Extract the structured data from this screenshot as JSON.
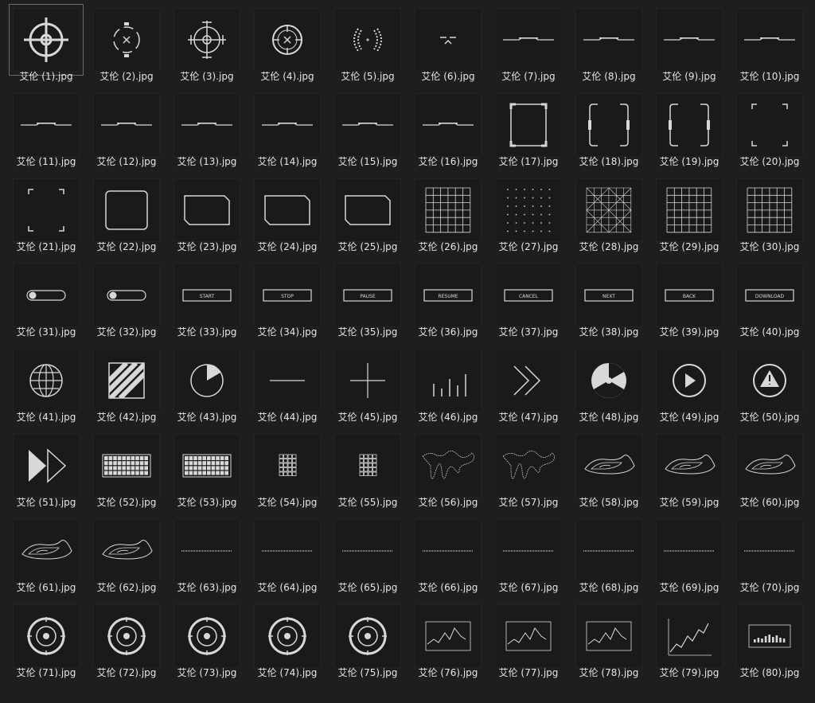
{
  "files": [
    {
      "name": "艾伦 (1).jpg",
      "icon": "crosshair-icon"
    },
    {
      "name": "艾伦 (2).jpg",
      "icon": "crosshair-x-icon"
    },
    {
      "name": "艾伦 (3).jpg",
      "icon": "crosshair-tick-icon"
    },
    {
      "name": "艾伦 (4).jpg",
      "icon": "crosshair-ring-icon"
    },
    {
      "name": "艾伦 (5).jpg",
      "icon": "bracket-arc-icon"
    },
    {
      "name": "艾伦 (6).jpg",
      "icon": "caret-mark-icon"
    },
    {
      "name": "艾伦 (7).jpg",
      "icon": "hud-line-icon"
    },
    {
      "name": "艾伦 (8).jpg",
      "icon": "hud-line-icon"
    },
    {
      "name": "艾伦 (9).jpg",
      "icon": "hud-line-icon"
    },
    {
      "name": "艾伦 (10).jpg",
      "icon": "hud-line-icon"
    },
    {
      "name": "艾伦 (11).jpg",
      "icon": "hud-line-icon"
    },
    {
      "name": "艾伦 (12).jpg",
      "icon": "hud-line-icon"
    },
    {
      "name": "艾伦 (13).jpg",
      "icon": "hud-line-icon"
    },
    {
      "name": "艾伦 (14).jpg",
      "icon": "hud-line-icon"
    },
    {
      "name": "艾伦 (15).jpg",
      "icon": "hud-line-icon"
    },
    {
      "name": "艾伦 (16).jpg",
      "icon": "hud-line-icon"
    },
    {
      "name": "艾伦 (17).jpg",
      "icon": "square-frame-icon"
    },
    {
      "name": "艾伦 (18).jpg",
      "icon": "bracket-frame-icon"
    },
    {
      "name": "艾伦 (19).jpg",
      "icon": "bracket-frame-icon"
    },
    {
      "name": "艾伦 (20).jpg",
      "icon": "corner-frame-icon"
    },
    {
      "name": "艾伦 (21).jpg",
      "icon": "corner-frame-icon"
    },
    {
      "name": "艾伦 (22).jpg",
      "icon": "rounded-frame-icon"
    },
    {
      "name": "艾伦 (23).jpg",
      "icon": "panel-frame-icon"
    },
    {
      "name": "艾伦 (24).jpg",
      "icon": "panel-frame-icon"
    },
    {
      "name": "艾伦 (25).jpg",
      "icon": "panel-frame-icon"
    },
    {
      "name": "艾伦 (26).jpg",
      "icon": "grid-icon"
    },
    {
      "name": "艾伦 (27).jpg",
      "icon": "dot-grid-icon"
    },
    {
      "name": "艾伦 (28).jpg",
      "icon": "diagonal-grid-icon"
    },
    {
      "name": "艾伦 (29).jpg",
      "icon": "grid-icon"
    },
    {
      "name": "艾伦 (30).jpg",
      "icon": "grid-icon"
    },
    {
      "name": "艾伦 (31).jpg",
      "icon": "toggle-icon"
    },
    {
      "name": "艾伦 (32).jpg",
      "icon": "toggle-icon"
    },
    {
      "name": "艾伦 (33).jpg",
      "icon": "button-icon",
      "text": "START"
    },
    {
      "name": "艾伦 (34).jpg",
      "icon": "button-icon",
      "text": "STOP"
    },
    {
      "name": "艾伦 (35).jpg",
      "icon": "button-icon",
      "text": "PAUSE"
    },
    {
      "name": "艾伦 (36).jpg",
      "icon": "button-icon",
      "text": "RESUME"
    },
    {
      "name": "艾伦 (37).jpg",
      "icon": "button-icon",
      "text": "CANCEL"
    },
    {
      "name": "艾伦 (38).jpg",
      "icon": "button-icon",
      "text": "NEXT"
    },
    {
      "name": "艾伦 (39).jpg",
      "icon": "button-icon",
      "text": "BACK"
    },
    {
      "name": "艾伦 (40).jpg",
      "icon": "button-icon",
      "text": "DOWNLOAD"
    },
    {
      "name": "艾伦 (41).jpg",
      "icon": "globe-icon"
    },
    {
      "name": "艾伦 (42).jpg",
      "icon": "hazard-stripes-icon"
    },
    {
      "name": "艾伦 (43).jpg",
      "icon": "pie-circle-icon"
    },
    {
      "name": "艾伦 (44).jpg",
      "icon": "minus-icon"
    },
    {
      "name": "艾伦 (45).jpg",
      "icon": "plus-icon"
    },
    {
      "name": "艾伦 (46).jpg",
      "icon": "bars-icon"
    },
    {
      "name": "艾伦 (47).jpg",
      "icon": "double-chevron-icon"
    },
    {
      "name": "艾伦 (48).jpg",
      "icon": "radiation-icon"
    },
    {
      "name": "艾伦 (49).jpg",
      "icon": "play-circle-icon"
    },
    {
      "name": "艾伦 (50).jpg",
      "icon": "warning-circle-icon"
    },
    {
      "name": "艾伦 (51).jpg",
      "icon": "fast-forward-icon"
    },
    {
      "name": "艾伦 (52).jpg",
      "icon": "keyboard-icon"
    },
    {
      "name": "艾伦 (53).jpg",
      "icon": "keyboard-icon"
    },
    {
      "name": "艾伦 (54).jpg",
      "icon": "keypad-icon"
    },
    {
      "name": "艾伦 (55).jpg",
      "icon": "keypad-icon"
    },
    {
      "name": "艾伦 (56).jpg",
      "icon": "world-map-icon"
    },
    {
      "name": "艾伦 (57).jpg",
      "icon": "world-map-icon"
    },
    {
      "name": "艾伦 (58).jpg",
      "icon": "terrain-icon"
    },
    {
      "name": "艾伦 (59).jpg",
      "icon": "terrain-icon"
    },
    {
      "name": "艾伦 (60).jpg",
      "icon": "terrain-icon"
    },
    {
      "name": "艾伦 (61).jpg",
      "icon": "terrain-icon"
    },
    {
      "name": "艾伦 (62).jpg",
      "icon": "terrain-icon"
    },
    {
      "name": "艾伦 (63).jpg",
      "icon": "dotted-line-icon"
    },
    {
      "name": "艾伦 (64).jpg",
      "icon": "dotted-line-icon"
    },
    {
      "name": "艾伦 (65).jpg",
      "icon": "dotted-line-icon"
    },
    {
      "name": "艾伦 (66).jpg",
      "icon": "dotted-line-icon"
    },
    {
      "name": "艾伦 (67).jpg",
      "icon": "dotted-line-icon"
    },
    {
      "name": "艾伦 (68).jpg",
      "icon": "dotted-line-icon"
    },
    {
      "name": "艾伦 (69).jpg",
      "icon": "dotted-line-icon"
    },
    {
      "name": "艾伦 (70).jpg",
      "icon": "dotted-line-icon"
    },
    {
      "name": "艾伦 (71).jpg",
      "icon": "dial-icon"
    },
    {
      "name": "艾伦 (72).jpg",
      "icon": "dial-icon"
    },
    {
      "name": "艾伦 (73).jpg",
      "icon": "dial-icon"
    },
    {
      "name": "艾伦 (74).jpg",
      "icon": "dial-icon"
    },
    {
      "name": "艾伦 (75).jpg",
      "icon": "dial-icon"
    },
    {
      "name": "艾伦 (76).jpg",
      "icon": "line-chart-icon"
    },
    {
      "name": "艾伦 (77).jpg",
      "icon": "line-chart-icon"
    },
    {
      "name": "艾伦 (78).jpg",
      "icon": "line-chart-icon"
    },
    {
      "name": "艾伦 (79).jpg",
      "icon": "trend-chart-icon"
    },
    {
      "name": "艾伦 (80).jpg",
      "icon": "bar-chart-icon"
    }
  ],
  "selected_index": 0,
  "colors": {
    "background": "#1e1e1e",
    "thumb": "#1a1a1a",
    "stroke": "#d8d8d8",
    "label": "#e6e6e6"
  }
}
